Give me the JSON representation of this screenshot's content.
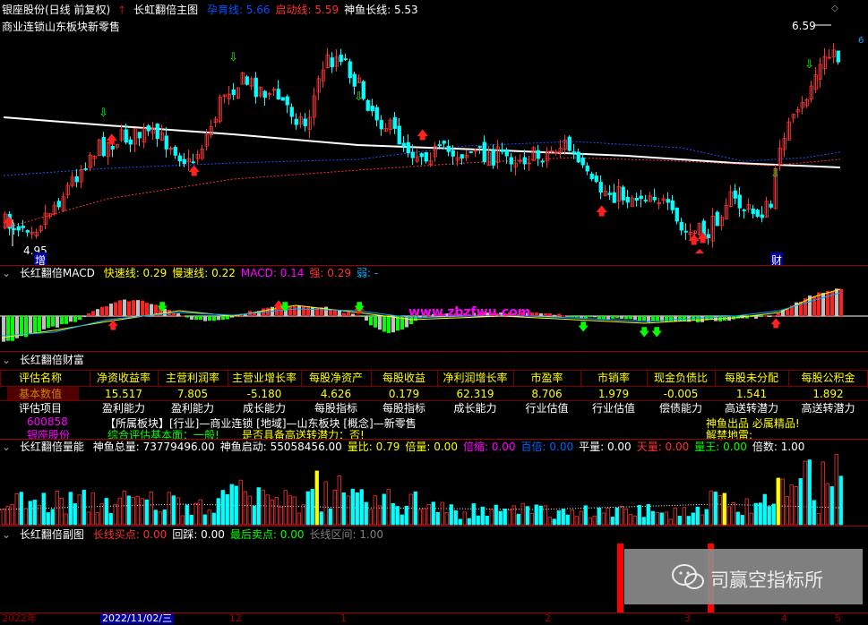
{
  "main": {
    "title": "银座股份(日线 前复权)",
    "indicator_name": "长虹翻倍主图",
    "lines": [
      {
        "label": "孕育线:",
        "value": "5.66",
        "color": "#0050ff"
      },
      {
        "label": "启动线:",
        "value": "5.59",
        "color": "#ff3030"
      },
      {
        "label": "神鱼长线:",
        "value": "5.53",
        "color": "#ffffff"
      }
    ],
    "sector_text": "商业连锁山东板块新零售",
    "high_label": "6.59",
    "low_label": "4.95",
    "mark_zeng": "增",
    "mark_cai": "财"
  },
  "macd": {
    "name": "长红翻倍MACD",
    "items": [
      {
        "label": "快速线:",
        "value": "0.29",
        "color": "#ffff00"
      },
      {
        "label": "慢速线:",
        "value": "0.22",
        "color": "#ffff00"
      },
      {
        "label": "MACD:",
        "value": "0.14",
        "color": "#ff00ff"
      },
      {
        "label": "强:",
        "value": "0.29",
        "color": "#ff3030"
      },
      {
        "label": "弱:",
        "value": "-",
        "color": "#00aaff"
      }
    ],
    "watermark": "www.zbzfwu.com"
  },
  "finance": {
    "name": "长红翻倍财富",
    "row_label_1": "评估名称",
    "headers": [
      "净资收益率",
      "主营利润率",
      "主营业增长率",
      "每股净资产",
      "每股收益",
      "净利润增长率",
      "市盈率",
      "市销率",
      "现金负债比",
      "每股未分配",
      "每股公积金"
    ],
    "row_label_2": "基本数值",
    "values": [
      "15.517",
      "7.805",
      "-5.180",
      "4.626",
      "0.179",
      "62.319",
      "8.706",
      "1.979",
      "-0.005",
      "1.541",
      "1.892"
    ],
    "row_label_3": "评估项目",
    "items": [
      "盈利能力",
      "盈利能力",
      "成长能力",
      "每股指标",
      "每股指标",
      "成长能力",
      "行业估值",
      "行业估值",
      "偿债能力",
      "高送转潜力",
      "高送转潜力"
    ],
    "code": "600858",
    "stock_name": "银座股份",
    "sector_line": "【所属板块】[行业]—商业连锁 [地域]—山东板块 [概念]—新零售",
    "eval_line": "综合评估基本面：一般!",
    "transfer_line": "是否具备高送转潜力：否!",
    "slogan": "神鱼出品 必属精品!",
    "unlock": "解禁地雷:"
  },
  "volume": {
    "name": "长红翻倍量能",
    "items": [
      {
        "label": "神鱼总量:",
        "value": "73779496.00",
        "color": "#ffffff"
      },
      {
        "label": "神鱼启动:",
        "value": "55058456.00",
        "color": "#ffffff"
      },
      {
        "label": "量比:",
        "value": "0.79",
        "color": "#ffff00"
      },
      {
        "label": "倍量:",
        "value": "0.00",
        "color": "#ffff00"
      },
      {
        "label": "倍缩:",
        "value": "0.00",
        "color": "#ff00ff"
      },
      {
        "label": "百倍:",
        "value": "0.00",
        "color": "#0060ff"
      },
      {
        "label": "平量:",
        "value": "0.00",
        "color": "#ffffff"
      },
      {
        "label": "天量:",
        "value": "0.00",
        "color": "#ff3030"
      },
      {
        "label": "量王:",
        "value": "0.00",
        "color": "#00ff00"
      },
      {
        "label": "倍数:",
        "value": "1.00",
        "color": "#ffffff"
      }
    ]
  },
  "sub": {
    "name": "长红翻倍副图",
    "items": [
      {
        "label": "长线买点:",
        "value": "0.00",
        "color": "#ff3030"
      },
      {
        "label": "回踩:",
        "value": "0.00",
        "color": "#ffffff"
      },
      {
        "label": "最后卖点:",
        "value": "0.00",
        "color": "#00ff00"
      },
      {
        "label": "长线区间:",
        "value": "1.00",
        "color": "#808080"
      }
    ]
  },
  "badge": {
    "text": "司赢空指标所",
    "wechat_icon": "wechat-icon"
  },
  "dates": [
    "2022年",
    "2022/11/02/三",
    "12",
    "1",
    "2",
    "3",
    "4",
    "5"
  ],
  "colors": {
    "up": "#ff3030",
    "down": "#00ffff",
    "frame": "#a00000",
    "grid": "#7a0000"
  }
}
